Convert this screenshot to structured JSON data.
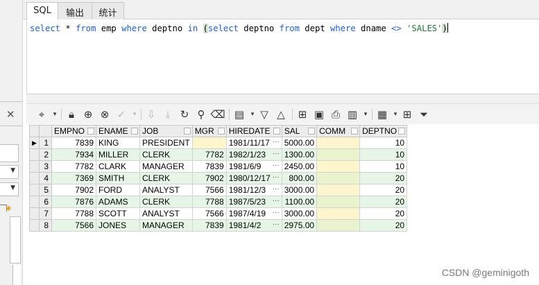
{
  "tabs": [
    {
      "label": "SQL",
      "active": true
    },
    {
      "label": "输出",
      "active": false
    },
    {
      "label": "统计",
      "active": false
    }
  ],
  "editor": {
    "tokens": [
      {
        "t": "select",
        "c": "kw"
      },
      {
        "t": " ",
        "c": ""
      },
      {
        "t": "*",
        "c": ""
      },
      {
        "t": " ",
        "c": ""
      },
      {
        "t": "from",
        "c": "kw"
      },
      {
        "t": " emp ",
        "c": ""
      },
      {
        "t": "where",
        "c": "kw"
      },
      {
        "t": " deptno ",
        "c": ""
      },
      {
        "t": "in",
        "c": "kw"
      },
      {
        "t": " ",
        "c": ""
      },
      {
        "t": "(",
        "c": "paren"
      },
      {
        "t": "select",
        "c": "kw"
      },
      {
        "t": " deptno ",
        "c": ""
      },
      {
        "t": "from",
        "c": "kw"
      },
      {
        "t": " dept ",
        "c": ""
      },
      {
        "t": "where",
        "c": "kw"
      },
      {
        "t": " dname ",
        "c": ""
      },
      {
        "t": "<>",
        "c": "kw"
      },
      {
        "t": " ",
        "c": ""
      },
      {
        "t": "'SALES'",
        "c": "str"
      },
      {
        "t": ")",
        "c": "paren"
      }
    ]
  },
  "left_panel": {
    "close_glyph": "✕",
    "select_arrow": "▼",
    "star_glyph": "✱"
  },
  "toolbar": {
    "icons": [
      {
        "name": "record-navigator-icon",
        "glyph": "⌖",
        "enabled": true
      },
      {
        "name": "dropdown-arrow-icon",
        "glyph": "▾",
        "enabled": true,
        "small": true
      },
      {
        "name": "lock-icon",
        "glyph": "🔒︎",
        "enabled": true
      },
      {
        "name": "add-record-icon",
        "glyph": "⊕",
        "enabled": true
      },
      {
        "name": "delete-record-icon",
        "glyph": "⊗",
        "enabled": true
      },
      {
        "name": "post-changes-icon",
        "glyph": "✓",
        "enabled": false
      },
      {
        "name": "dropdown-arrow-icon",
        "glyph": "▾",
        "enabled": false,
        "small": true
      },
      {
        "name": "fetch-next-icon",
        "glyph": "⇩",
        "enabled": false
      },
      {
        "name": "fetch-last-icon",
        "glyph": "⤓",
        "enabled": false
      },
      {
        "name": "refresh-icon",
        "glyph": "↻",
        "enabled": true
      },
      {
        "name": "query-by-example-icon",
        "glyph": "⚲",
        "enabled": true
      },
      {
        "name": "clear-icon",
        "glyph": "⌫",
        "enabled": true
      },
      {
        "name": "single-record-view-icon",
        "glyph": "▤",
        "enabled": true
      },
      {
        "name": "dropdown-arrow-icon",
        "glyph": "▾",
        "enabled": true,
        "small": true
      },
      {
        "name": "sort-down-icon",
        "glyph": "▽",
        "enabled": true
      },
      {
        "name": "sort-up-icon",
        "glyph": "△",
        "enabled": true
      },
      {
        "name": "export-icon",
        "glyph": "⊞",
        "enabled": true
      },
      {
        "name": "save-icon",
        "glyph": "▣",
        "enabled": true
      },
      {
        "name": "print-icon",
        "glyph": "⎙",
        "enabled": true
      },
      {
        "name": "bar-chart-icon",
        "glyph": "▥",
        "enabled": true
      },
      {
        "name": "dropdown-arrow-icon",
        "glyph": "▾",
        "enabled": true,
        "small": true
      },
      {
        "name": "grid-layout-icon",
        "glyph": "▦",
        "enabled": true
      },
      {
        "name": "dropdown-arrow-icon",
        "glyph": "▾",
        "enabled": true,
        "small": true
      },
      {
        "name": "table-view-icon",
        "glyph": "⊞",
        "enabled": true
      },
      {
        "name": "filter-icon",
        "glyph": "⏷",
        "enabled": true
      }
    ]
  },
  "grid": {
    "current_row_marker": "▶",
    "ellipsis": "···",
    "columns": [
      "EMPNO",
      "ENAME",
      "JOB",
      "MGR",
      "HIREDATE",
      "SAL",
      "COMM",
      "DEPTNO"
    ],
    "rows": [
      {
        "num": "1",
        "empno": "7839",
        "ename": "KING",
        "job": "PRESIDENT",
        "mgr": "",
        "hiredate": "1981/11/17",
        "sal": "5000.00",
        "comm": "",
        "deptno": "10"
      },
      {
        "num": "2",
        "empno": "7934",
        "ename": "MILLER",
        "job": "CLERK",
        "mgr": "7782",
        "hiredate": "1982/1/23",
        "sal": "1300.00",
        "comm": "",
        "deptno": "10"
      },
      {
        "num": "3",
        "empno": "7782",
        "ename": "CLARK",
        "job": "MANAGER",
        "mgr": "7839",
        "hiredate": "1981/6/9",
        "sal": "2450.00",
        "comm": "",
        "deptno": "10"
      },
      {
        "num": "4",
        "empno": "7369",
        "ename": "SMITH",
        "job": "CLERK",
        "mgr": "7902",
        "hiredate": "1980/12/17",
        "sal": "800.00",
        "comm": "",
        "deptno": "20"
      },
      {
        "num": "5",
        "empno": "7902",
        "ename": "FORD",
        "job": "ANALYST",
        "mgr": "7566",
        "hiredate": "1981/12/3",
        "sal": "3000.00",
        "comm": "",
        "deptno": "20"
      },
      {
        "num": "6",
        "empno": "7876",
        "ename": "ADAMS",
        "job": "CLERK",
        "mgr": "7788",
        "hiredate": "1987/5/23",
        "sal": "1100.00",
        "comm": "",
        "deptno": "20"
      },
      {
        "num": "7",
        "empno": "7788",
        "ename": "SCOTT",
        "job": "ANALYST",
        "mgr": "7566",
        "hiredate": "1987/4/19",
        "sal": "3000.00",
        "comm": "",
        "deptno": "20"
      },
      {
        "num": "8",
        "empno": "7566",
        "ename": "JONES",
        "job": "MANAGER",
        "mgr": "7839",
        "hiredate": "1981/4/2",
        "sal": "2975.00",
        "comm": "",
        "deptno": "20"
      }
    ]
  },
  "watermark": "CSDN @geminigoth",
  "colors": {
    "keyword": "#1c5fd6",
    "string": "#1a7f37",
    "row_even": "#e6f6e6",
    "null_cell": "#fdf6cc"
  }
}
